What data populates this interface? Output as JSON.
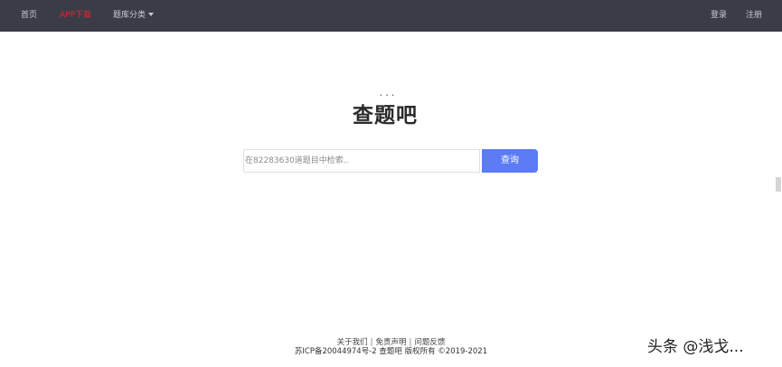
{
  "nav": {
    "home": "首页",
    "app_download": "APP下载",
    "categories": "题库分类",
    "login": "登录",
    "register": "注册"
  },
  "logo": {
    "text": "查题吧",
    "dots": "• • •"
  },
  "search": {
    "placeholder": "在82283630道题目中检索..",
    "button": "查询"
  },
  "footer": {
    "about": "关于我们",
    "separator": "|",
    "disclaimer": "免责声明",
    "feedback": "问题反馈",
    "copyright": "苏ICP备20044974号-2 查题吧  版权所有 ©2019-2021"
  },
  "watermark": "头条 @浅戈..."
}
